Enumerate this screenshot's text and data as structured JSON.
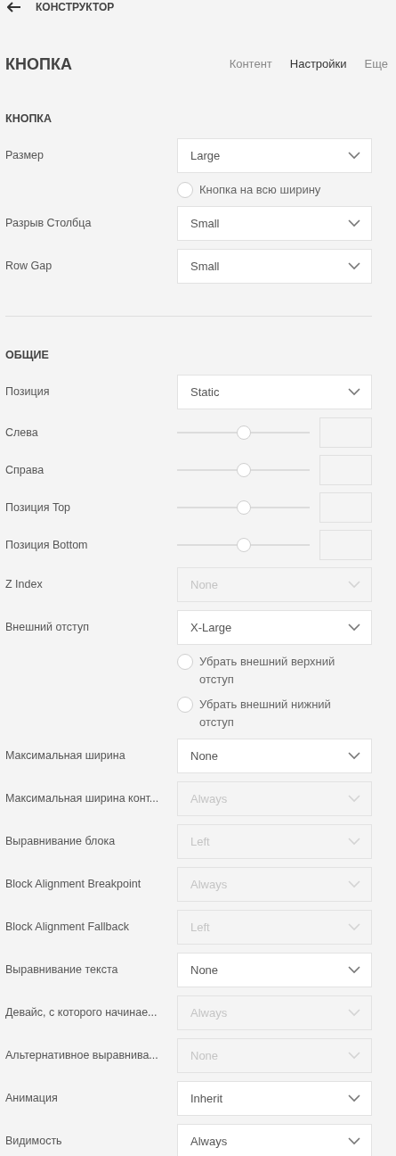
{
  "header": {
    "back_label": "КОНСТРУКТОР"
  },
  "panel": {
    "title": "КНОПКА",
    "tabs": [
      {
        "label": "Контент",
        "selected": false
      },
      {
        "label": "Настройки",
        "selected": true
      },
      {
        "label": "Еще",
        "selected": false
      }
    ]
  },
  "sections": [
    {
      "title": "КНОПКА",
      "rows": [
        {
          "kind": "select",
          "label": "Размер",
          "value": "Large",
          "disabled": false
        },
        {
          "kind": "checkbox",
          "label": "Кнопка на всю ширину",
          "checked": false
        },
        {
          "kind": "select",
          "label": "Разрыв Столбца",
          "value": "Small",
          "disabled": false
        },
        {
          "kind": "select",
          "label": "Row Gap",
          "value": "Small",
          "disabled": false
        }
      ]
    },
    {
      "title": "ОБЩИЕ",
      "rows": [
        {
          "kind": "select",
          "label": "Позиция",
          "value": "Static",
          "disabled": false
        },
        {
          "kind": "slider",
          "label": "Слева",
          "level": 0.5
        },
        {
          "kind": "slider",
          "label": "Справа",
          "level": 0.5
        },
        {
          "kind": "slider",
          "label": "Позиция Top",
          "level": 0.5
        },
        {
          "kind": "slider",
          "label": "Позиция Bottom",
          "level": 0.5
        },
        {
          "kind": "select",
          "label": "Z Index",
          "value": "None",
          "disabled": true
        },
        {
          "kind": "select",
          "label": "Внешний отступ",
          "value": "X-Large",
          "disabled": false
        },
        {
          "kind": "checkbox",
          "label": "Убрать внешний верхний отступ",
          "checked": false
        },
        {
          "kind": "checkbox",
          "label": "Убрать внешний нижний отступ",
          "checked": false
        },
        {
          "kind": "select",
          "label": "Максимальная ширина",
          "value": "None",
          "disabled": false
        },
        {
          "kind": "select",
          "label": "Максимальная ширина конт...",
          "value": "Always",
          "disabled": true
        },
        {
          "kind": "select",
          "label": "Выравнивание блока",
          "value": "Left",
          "disabled": true
        },
        {
          "kind": "select",
          "label": "Block Alignment Breakpoint",
          "value": "Always",
          "disabled": true
        },
        {
          "kind": "select",
          "label": "Block Alignment Fallback",
          "value": "Left",
          "disabled": true
        },
        {
          "kind": "select",
          "label": "Выравнивание текста",
          "value": "None",
          "disabled": false
        },
        {
          "kind": "select",
          "label": "Девайс, с которого начинае...",
          "value": "Always",
          "disabled": true
        },
        {
          "kind": "select",
          "label": "Альтернативное выравнива...",
          "value": "None",
          "disabled": true
        },
        {
          "kind": "select",
          "label": "Анимация",
          "value": "Inherit",
          "disabled": false
        },
        {
          "kind": "select",
          "label": "Видимость",
          "value": "Always",
          "disabled": false
        }
      ]
    }
  ]
}
